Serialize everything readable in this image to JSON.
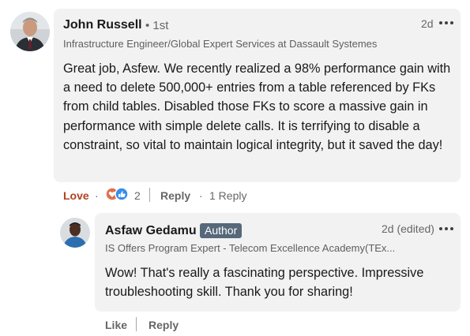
{
  "comment": {
    "author": {
      "name": "John Russell",
      "degree": "1st",
      "headline": "Infrastructure Engineer/Global Expert Services at Dassault Systemes"
    },
    "time": "2d",
    "text": "Great job, Asfew. We recently realized a 98% performance gain with a need to delete 500,000+ entries from a table referenced by FKs from child tables. Disabled those FKs to score a massive gain in performance with simple delete calls. It is terrifying to disable a constraint, so vital to maintain logical integrity, but it saved the day!",
    "actions": {
      "love_label": "Love",
      "separator": "·",
      "reaction_count": "2",
      "reply_label": "Reply",
      "replies_label": "1 Reply"
    },
    "reaction_icons": [
      "love-icon",
      "like-icon"
    ]
  },
  "reply": {
    "author": {
      "name": "Asfaw Gedamu",
      "badge": "Author",
      "headline": "IS Offers Program Expert - Telecom Excellence Academy(TEx..."
    },
    "time": "2d (edited)",
    "text": "Wow! That's really a fascinating perspective. Impressive troubleshooting skill. Thank you for sharing!",
    "actions": {
      "like_label": "Like",
      "reply_label": "Reply"
    }
  },
  "colors": {
    "bubble": "#f2f2f2",
    "love": "#b24020",
    "like_blue": "#378fe9",
    "badge": "#56687a"
  }
}
